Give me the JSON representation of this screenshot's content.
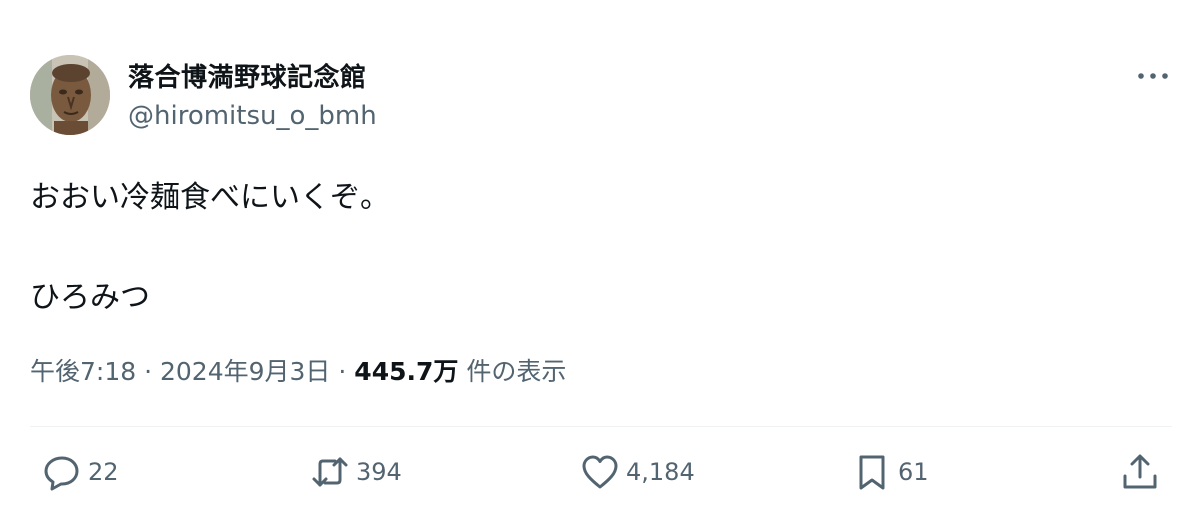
{
  "tweet": {
    "author_name": "落合博満野球記念館",
    "author_handle": "@hiromitsu_o_bmh",
    "text_line1": "おおい冷麺食べにいくぞ。",
    "text_line2": "ひろみつ",
    "time": "午後7:18",
    "date": "2024年9月3日",
    "separator": "·",
    "views_count": "445.7万",
    "views_label": "件の表示"
  },
  "actions": {
    "reply_count": "22",
    "retweet_count": "394",
    "like_count": "4,184",
    "bookmark_count": "61"
  },
  "colors": {
    "text": "#0f1419",
    "secondary": "#536471",
    "divider": "#eff3f4"
  },
  "icons": [
    "avatar",
    "more-icon",
    "reply-icon",
    "retweet-icon",
    "like-icon",
    "bookmark-icon",
    "share-icon"
  ]
}
